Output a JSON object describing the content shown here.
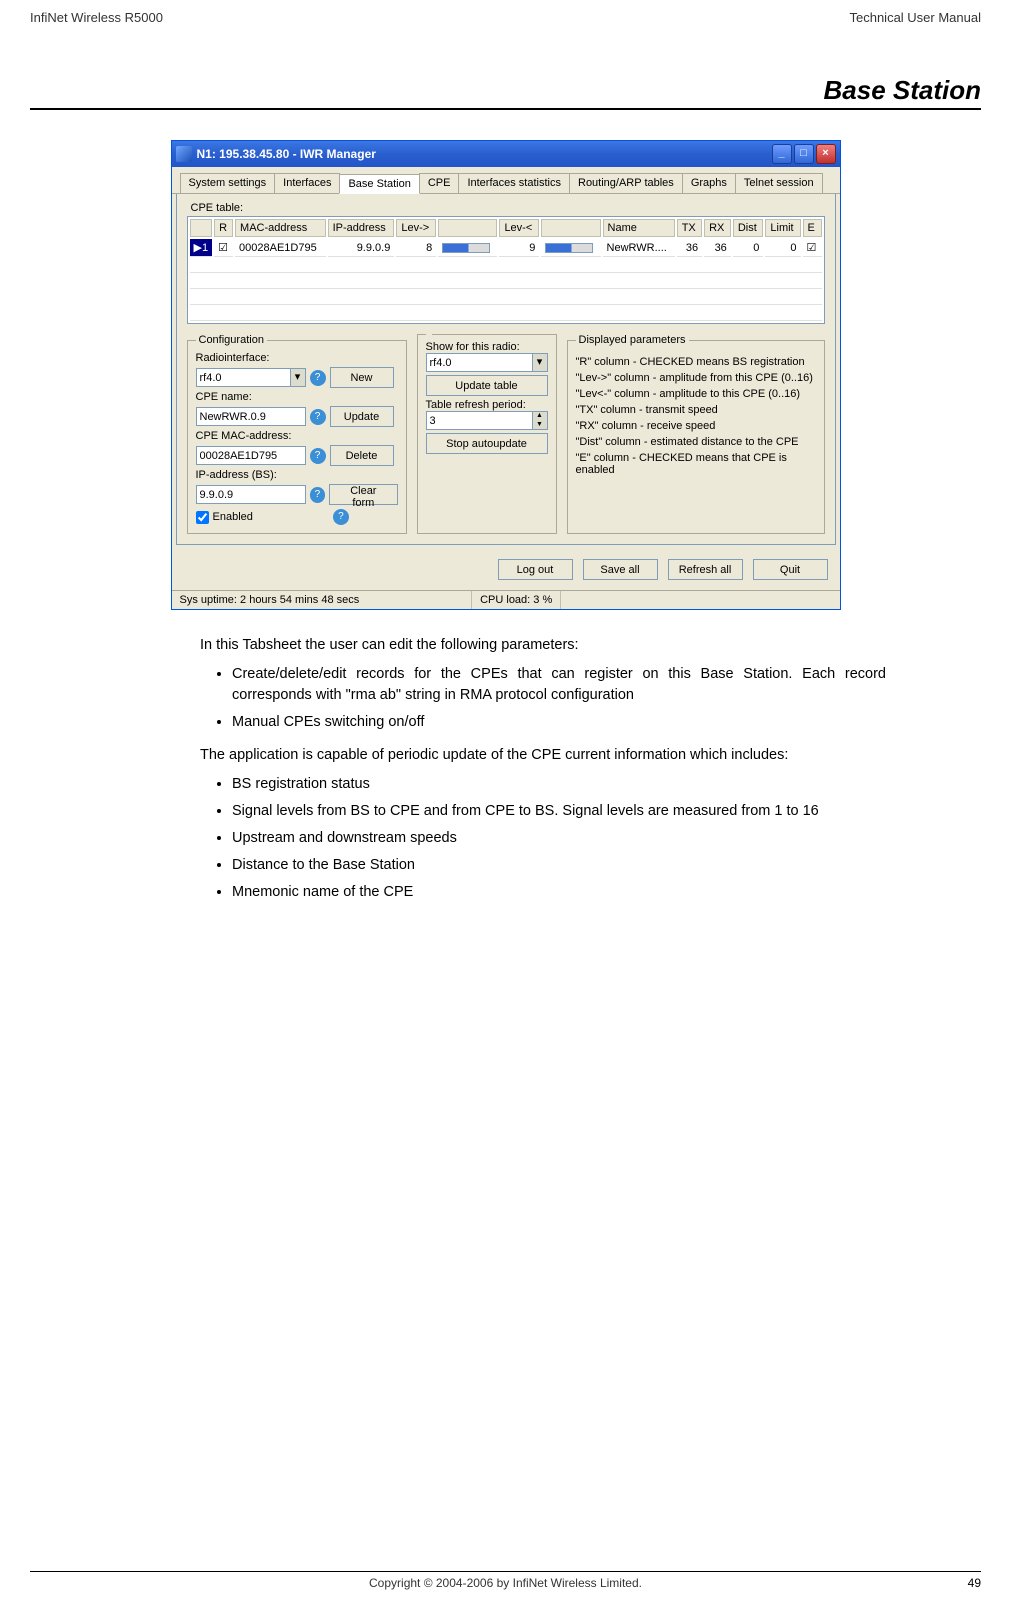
{
  "page": {
    "header_left": "InfiNet Wireless R5000",
    "header_right": "Technical User Manual",
    "section_title": "Base Station",
    "footer_copyright": "Copyright © 2004-2006 by InfiNet Wireless Limited.",
    "page_number": "49"
  },
  "window": {
    "title": "N1: 195.38.45.80 - IWR Manager",
    "tabs": [
      "System settings",
      "Interfaces",
      "Base Station",
      "CPE",
      "Interfaces statistics",
      "Routing/ARP tables",
      "Graphs",
      "Telnet session"
    ],
    "active_tab_index": 2,
    "cpe_table_label": "CPE table:",
    "columns": [
      "",
      "R",
      "MAC-address",
      "IP-address",
      "Lev->",
      "",
      "Lev-<",
      "",
      "Name",
      "TX",
      "RX",
      "Dist",
      "Limit",
      "E"
    ],
    "row": {
      "id": "1",
      "r_checked": "☑",
      "mac": "00028AE1D795",
      "ip": "9.9.0.9",
      "lev_to": "8",
      "lev_from": "9",
      "name": "NewRWR....",
      "tx": "36",
      "rx": "36",
      "dist": "0",
      "limit": "0",
      "e_checked": "☑"
    },
    "config": {
      "legend": "Configuration",
      "radio_label": "Radiointerface:",
      "radio_value": "rf4.0",
      "cpe_name_label": "CPE name:",
      "cpe_name_value": "NewRWR.0.9",
      "mac_label": "CPE MAC-address:",
      "mac_value": "00028AE1D795",
      "ip_label": "IP-address (BS):",
      "ip_value": "9.9.0.9",
      "enabled_label": "Enabled",
      "buttons": {
        "new": "New",
        "update": "Update",
        "delete": "Delete",
        "clear": "Clear form"
      }
    },
    "refresh": {
      "show_label": "Show for this radio:",
      "show_value": "rf4.0",
      "update_table": "Update table",
      "period_label": "Table refresh period:",
      "period_value": "3",
      "stop": "Stop autoupdate"
    },
    "displayed": {
      "legend": "Displayed parameters",
      "lines": [
        "\"R\" column - CHECKED means BS registration",
        "\"Lev->\" column - amplitude from this CPE (0..16)",
        "\"Lev<-\" column - amplitude to this CPE (0..16)",
        "\"TX\" column - transmit speed",
        "\"RX\" column - receive speed",
        "\"Dist\" column - estimated distance to the CPE",
        "\"E\" column - CHECKED means  that CPE is enabled"
      ]
    },
    "footer_buttons": {
      "logout": "Log out",
      "save": "Save all",
      "refresh": "Refresh all",
      "quit": "Quit"
    },
    "status": {
      "uptime": "Sys uptime: 2 hours 54 mins 48 secs",
      "cpu": "CPU load: 3 %"
    }
  },
  "body": {
    "intro": "In this Tabsheet the user can edit the following parameters:",
    "list1": [
      "Create/delete/edit records for the CPEs that can register on this Base Station. Each record corresponds with \"rma ab\" string in RMA protocol configuration",
      "Manual CPEs switching on/off"
    ],
    "para2": "The application is capable of periodic update of the CPE current information which includes:",
    "list2": [
      "BS registration status",
      "Signal levels from BS to CPE and from CPE to BS. Signal levels are measured from 1 to 16",
      "Upstream and downstream speeds",
      "Distance to the Base Station",
      "Mnemonic name of the CPE"
    ]
  }
}
